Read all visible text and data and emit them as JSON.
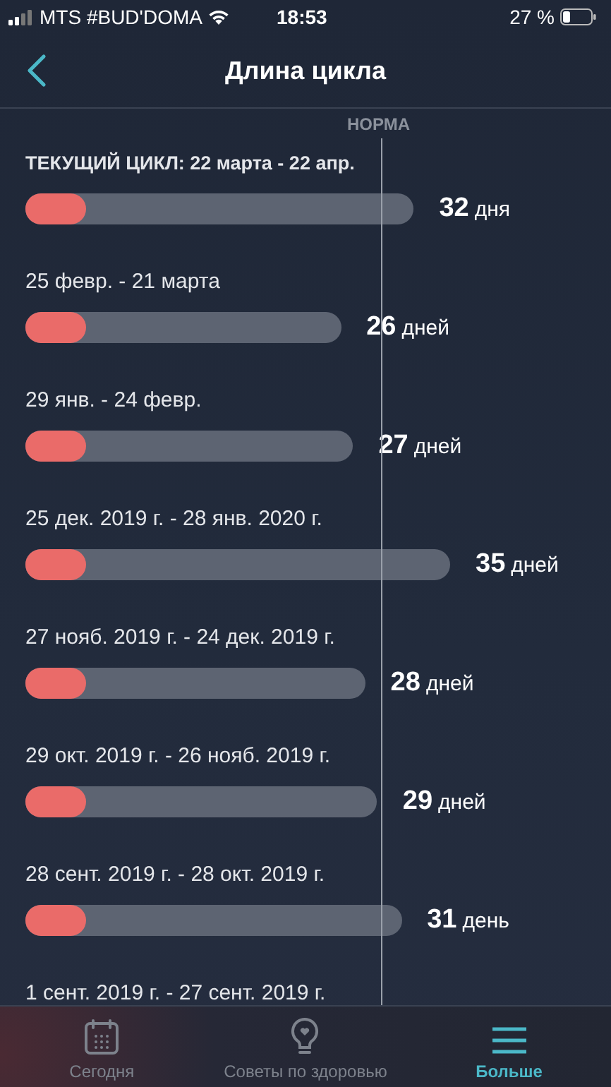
{
  "status_bar": {
    "carrier": "MTS #BUD'DOMA",
    "time": "18:53",
    "battery": "27 %"
  },
  "nav": {
    "title": "Длина цикла"
  },
  "norm": {
    "label": "НОРМА"
  },
  "cycles": [
    {
      "label": "ТЕКУЩИЙ ЦИКЛ: 22 марта - 22 апр.",
      "current": true,
      "days": "32",
      "unit": "дня"
    },
    {
      "label": "25 февр. - 21 марта",
      "current": false,
      "days": "26",
      "unit": "дней"
    },
    {
      "label": "29 янв. - 24 февр.",
      "current": false,
      "days": "27",
      "unit": "дней"
    },
    {
      "label": "25 дек. 2019 г. - 28 янв. 2020 г.",
      "current": false,
      "days": "35",
      "unit": "дней"
    },
    {
      "label": "27 нояб. 2019 г. - 24 дек. 2019 г.",
      "current": false,
      "days": "28",
      "unit": "дней"
    },
    {
      "label": "29 окт. 2019 г. - 26 нояб. 2019 г.",
      "current": false,
      "days": "29",
      "unit": "дней"
    },
    {
      "label": "28 сент. 2019 г. - 28 окт. 2019 г.",
      "current": false,
      "days": "31",
      "unit": "день"
    },
    {
      "label": "1 сент. 2019 г. - 27 сент. 2019 г.",
      "current": false
    }
  ],
  "tabs": [
    {
      "kind": "calendar",
      "label": "Сегодня",
      "selected": false
    },
    {
      "kind": "bulb",
      "label": "Советы по здоровью",
      "selected": false
    },
    {
      "kind": "menu",
      "label": "Больше",
      "selected": true
    }
  ]
}
